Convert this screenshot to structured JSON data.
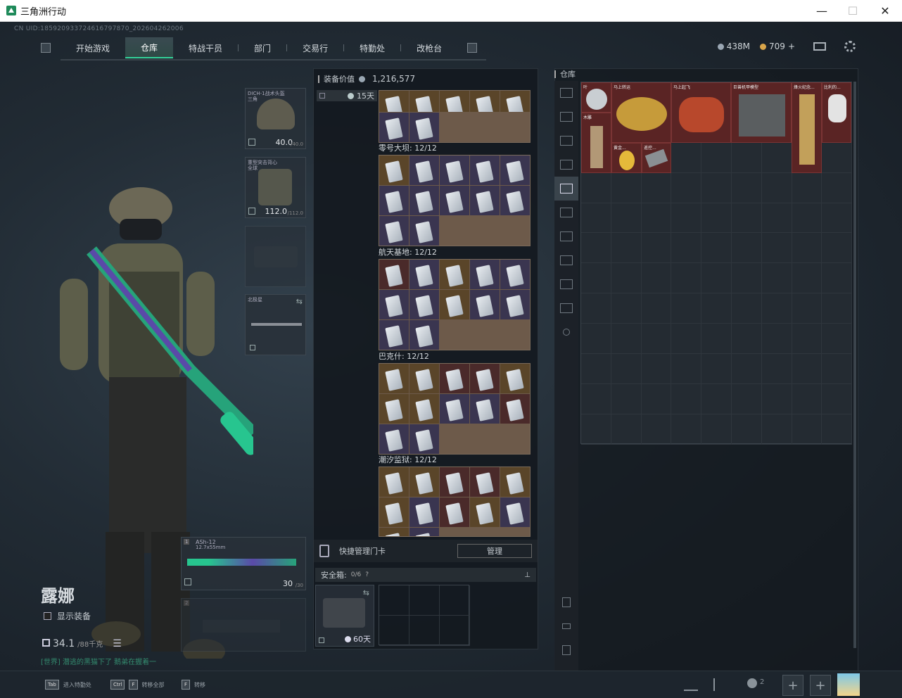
{
  "window": {
    "title": "三角洲行动",
    "min": "—",
    "max": "☐",
    "close": "✕"
  },
  "uid": "CN UID:185920933724616797870_202604262006",
  "nav": {
    "tabs": [
      "开始游戏",
      "仓库",
      "特战干员",
      "部门",
      "交易行",
      "特勤处",
      "改枪台"
    ],
    "active": 1
  },
  "currency": {
    "money": "438M",
    "coins": "709",
    "plus": "+",
    "money_color": "#9aa7b3",
    "coin_color": "#d8a54a"
  },
  "character": {
    "name": "露娜",
    "show_equip": "显示装备",
    "weight": "34.1",
    "weight_max": "/88千克"
  },
  "world_msg": "[世界] 潜逃的黑猫下了 鹅弟在握着一",
  "equipment": {
    "helmet": {
      "label": "DICH-1战术头盔",
      "sub": "三角",
      "dur": "40.0",
      "dur_max": "/40.0"
    },
    "armor": {
      "label": "重型突击背心",
      "sub": "全球",
      "dur": "112.0",
      "dur_max": "/112.0"
    },
    "melee": {
      "label": "北极星"
    },
    "primary": {
      "slot": "1",
      "name": "ASh-12",
      "caliber": "12.7x55mm",
      "ammo": "30",
      "ammo_max": "/30"
    },
    "secondary": {
      "slot": "2"
    }
  },
  "mid": {
    "value_label": "装备价值",
    "value": "1,216,577",
    "timer": "15天",
    "sections": [
      {
        "name": "零号大坝: 12/12"
      },
      {
        "name": "航天基地: 12/12"
      },
      {
        "name": "巴克什: 12/12"
      },
      {
        "name": "潮汐监狱: 12/12"
      }
    ],
    "quick_card": "快捷管理门卡",
    "manage": "管理",
    "safe": {
      "label": "安全箱:",
      "count": "0/6",
      "help": "?",
      "timer": "60天"
    }
  },
  "warehouse": {
    "title": "仓库",
    "items": [
      {
        "name": "叶"
      },
      {
        "name": "马上转运"
      },
      {
        "name": "马上起飞"
      },
      {
        "name": "巨兽机甲模型"
      },
      {
        "name": "烽火纪念..."
      },
      {
        "name": "比利的..."
      },
      {
        "name": "木雕"
      },
      {
        "name": "黄金..."
      },
      {
        "name": "遥控..."
      }
    ]
  },
  "bottom": {
    "hints": [
      {
        "key": "Tab",
        "text": "进入特勤处"
      },
      {
        "key": "Ctrl",
        "key2": "F",
        "text": "转移全部"
      },
      {
        "key": "F",
        "text": "转移"
      }
    ],
    "friends": "2",
    "plus1": "+",
    "plus2": "+"
  }
}
